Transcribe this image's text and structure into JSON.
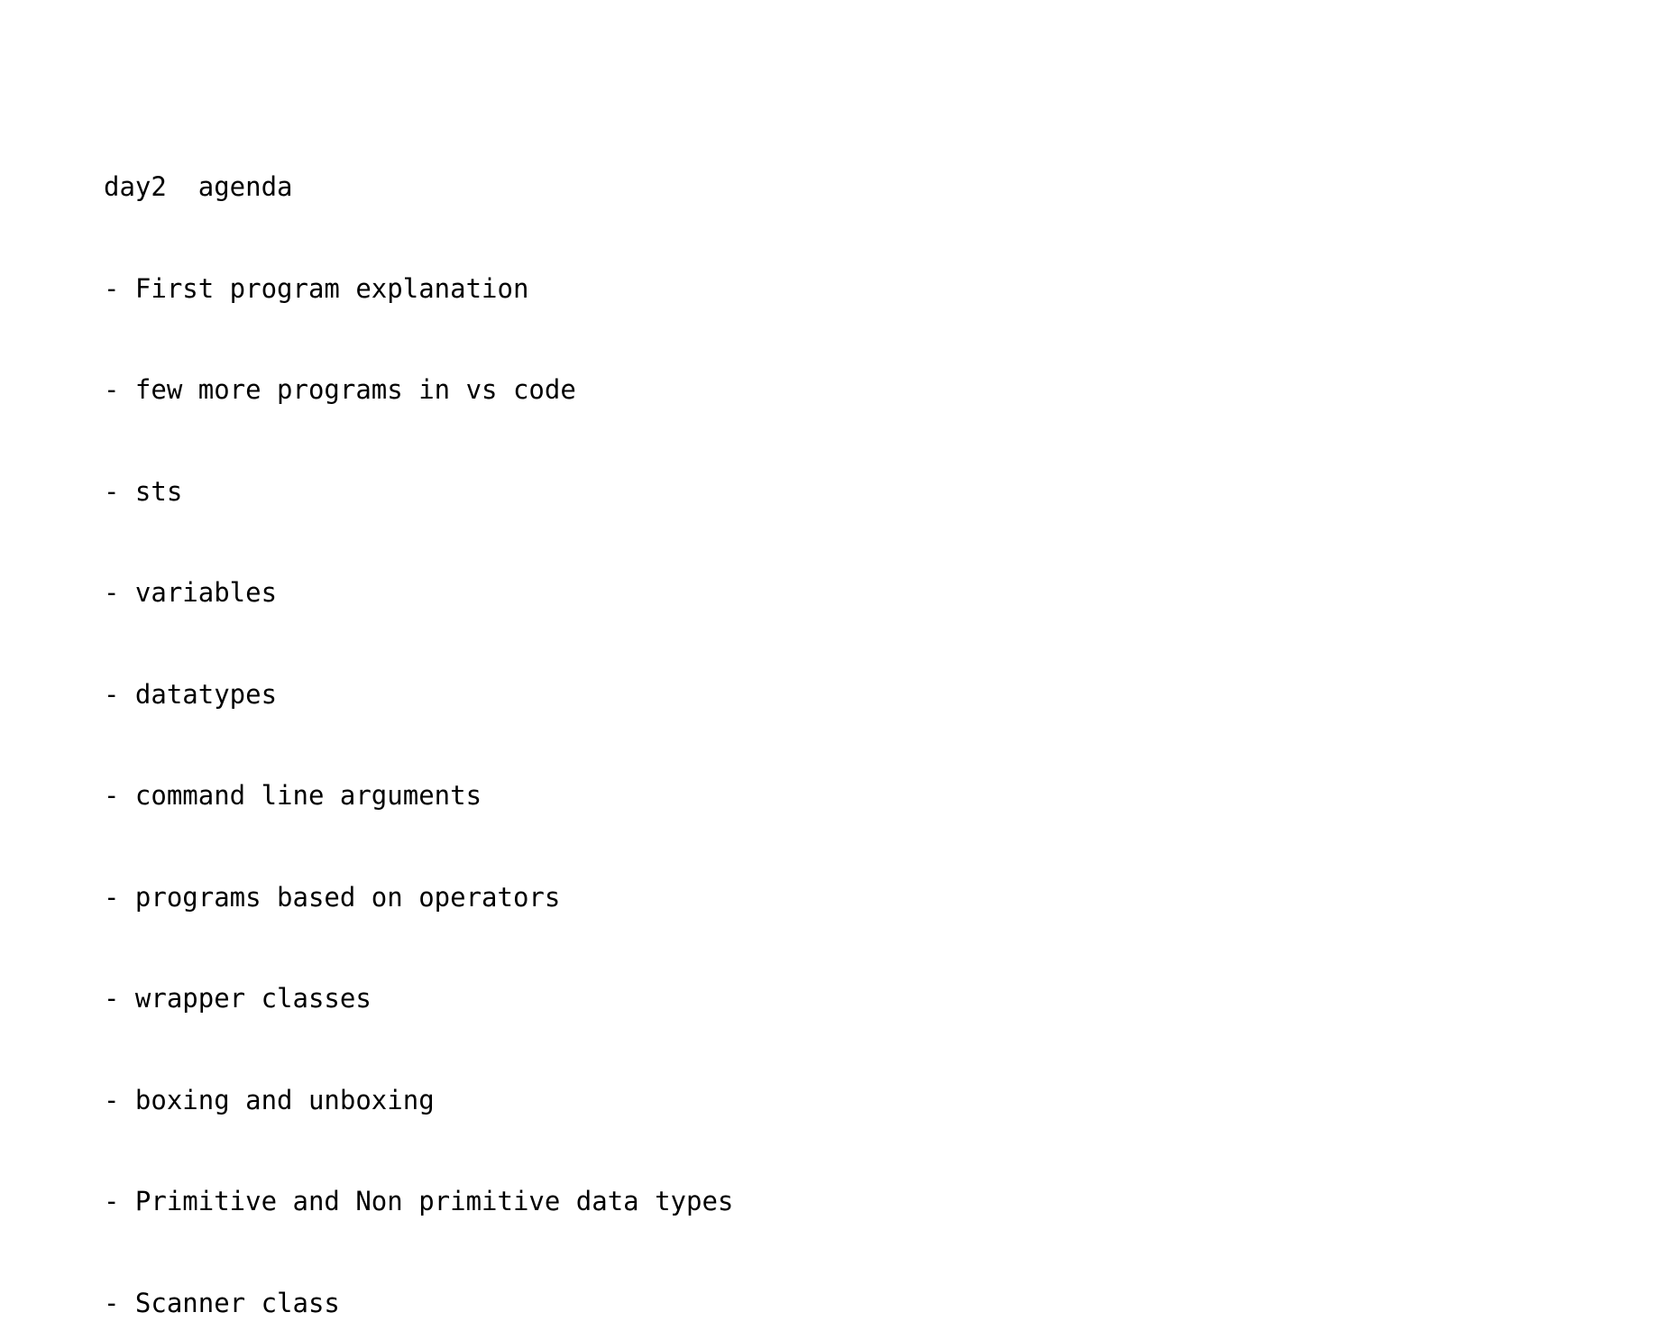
{
  "document": {
    "title": "day2  agenda",
    "items": [
      "- First program explanation",
      "- few more programs in vs code",
      "- sts",
      "- variables",
      "- datatypes",
      "- command line arguments",
      "- programs based on operators",
      "- wrapper classes",
      "- boxing and unboxing",
      "- Primitive and Non primitive data types",
      "- Scanner class"
    ]
  }
}
